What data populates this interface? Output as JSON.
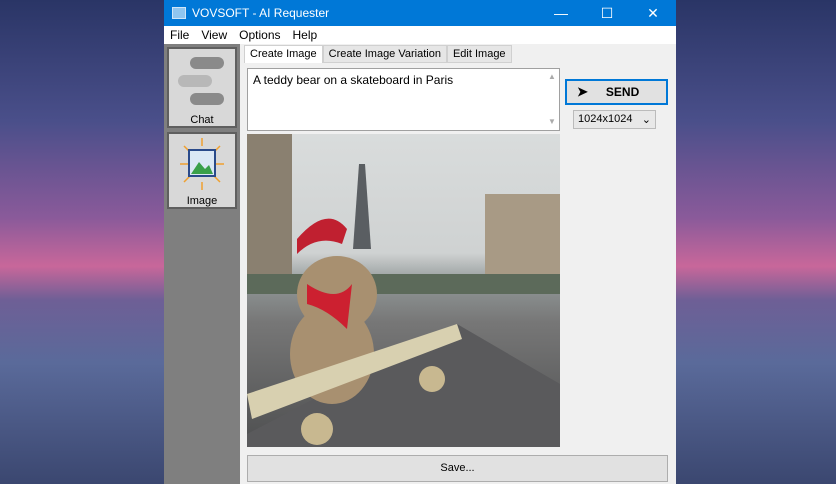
{
  "window": {
    "title": "VOVSOFT - AI Requester",
    "minimize": "—",
    "maximize": "☐",
    "close": "✕"
  },
  "menu": [
    "File",
    "View",
    "Options",
    "Help"
  ],
  "sidebar": [
    {
      "label": "Chat"
    },
    {
      "label": "Image"
    }
  ],
  "tabs": [
    {
      "label": "Create Image",
      "active": true
    },
    {
      "label": "Create Image Variation"
    },
    {
      "label": "Edit Image"
    }
  ],
  "prompt": {
    "value": "A teddy bear on a skateboard in Paris"
  },
  "send_label": "SEND",
  "size_select": {
    "value": "1024x1024"
  },
  "save_label": "Save...",
  "colors": {
    "titlebar": "#0078d7",
    "sidebar": "#7f7f7f"
  }
}
